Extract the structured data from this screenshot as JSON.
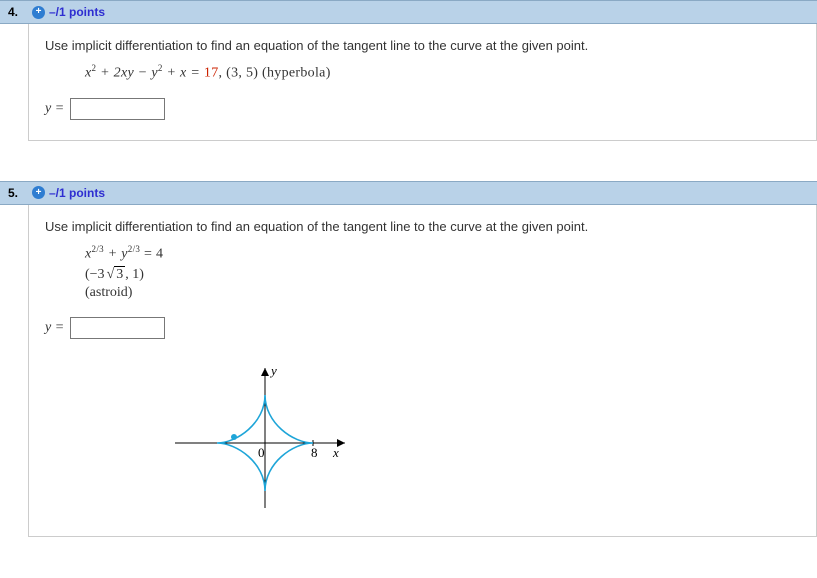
{
  "questions": [
    {
      "number": "4.",
      "points_label": "–/1 points",
      "instruction": "Use implicit differentiation to find an equation of the tangent line to the curve at the given point.",
      "eq_prefix_html": "x",
      "eq_sup1": "2",
      "eq_plus1": " + 2xy − y",
      "eq_sup2": "2",
      "eq_plusx": " + x = ",
      "eq_highlight": "17",
      "eq_pt": ",  (3, 5)   ",
      "eq_type": "(hyperbola)",
      "answer_label": "y ="
    },
    {
      "number": "5.",
      "points_label": "–/1 points",
      "instruction": "Use implicit differentiation to find an equation of the tangent line to the curve at the given point.",
      "eq_x": "x",
      "eq_expA": "2/3",
      "eq_plus": " + y",
      "eq_expB": "2/3",
      "eq_eq": " = 4",
      "pt_left": "(−3",
      "pt_sqrt": "3",
      "pt_right": ", 1)",
      "curve_type": "(astroid)",
      "answer_label": "y ="
    }
  ],
  "chart_data": {
    "type": "line",
    "title": "astroid",
    "xlabel": "x",
    "ylabel": "y",
    "x_ticks": [
      0,
      8
    ],
    "note": "Astroid curve x^(2/3)+y^(2/3)=4, shown with axes; tick at x=8; point near (-3√3,1) highlighted.",
    "point": {
      "x": -5.196,
      "y": 1
    }
  }
}
